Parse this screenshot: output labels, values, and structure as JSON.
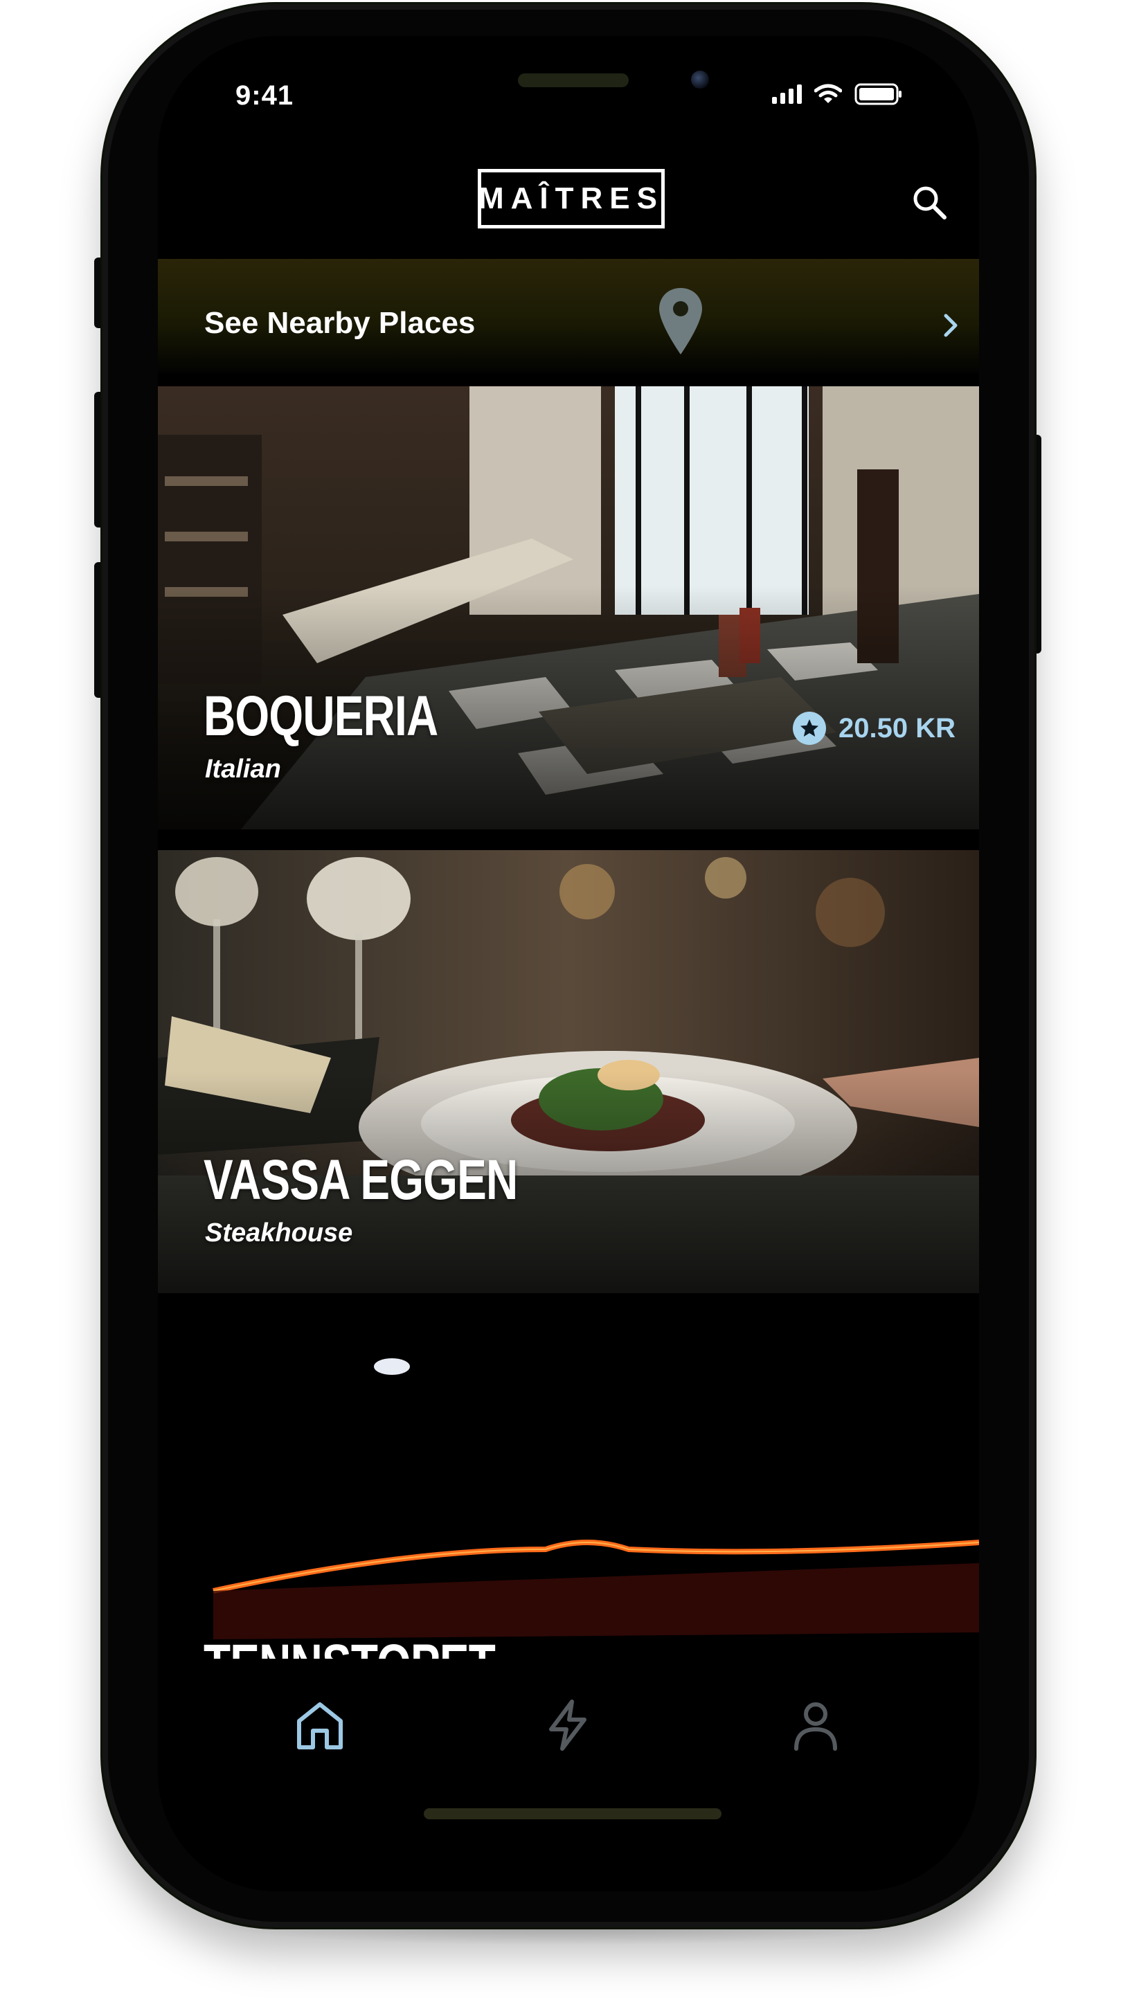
{
  "status_bar": {
    "time": "9:41",
    "icons": [
      "cellular-signal-icon",
      "wifi-icon",
      "battery-icon"
    ]
  },
  "header": {
    "logo_text": "MAÎTRES",
    "search_icon": "search-icon"
  },
  "nearby": {
    "label": "See Nearby Places",
    "icon": "location-pin-icon",
    "chevron": "chevron-right-icon"
  },
  "restaurants": [
    {
      "name": "BOQUERIA",
      "cuisine": "Italian",
      "price": "20.50 KR",
      "badge_icon": "star-icon"
    },
    {
      "name": "VASSA EGGEN",
      "cuisine": "Steakhouse"
    },
    {
      "name": "TENNSTOPET",
      "cuisine": ""
    }
  ],
  "tab_bar": {
    "items": [
      {
        "name": "home",
        "icon": "home-icon",
        "active": true
      },
      {
        "name": "activity",
        "icon": "lightning-icon",
        "active": false
      },
      {
        "name": "profile",
        "icon": "profile-icon",
        "active": false
      }
    ],
    "active_color": "#9cc8e4",
    "inactive_color": "#555a5f"
  },
  "colors": {
    "accent": "#a8d4ee",
    "background": "#000000",
    "nearby_strip": "#2a2508"
  }
}
